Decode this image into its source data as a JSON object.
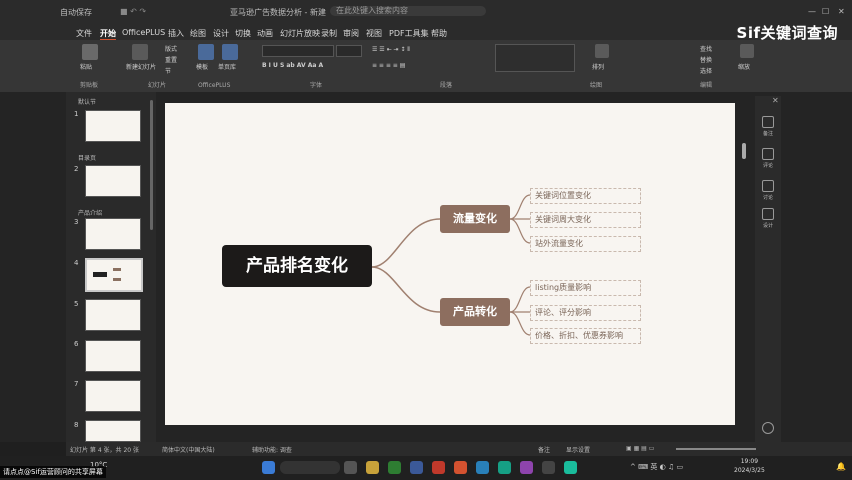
{
  "title_bar": {
    "autosave": "自动保存",
    "filename": "亚马逊广告数据分析 - 新建",
    "search": "在此处键入搜索内容"
  },
  "menu_tabs": [
    "文件",
    "开始",
    "OfficePLUS",
    "插入",
    "绘图",
    "设计",
    "切换",
    "动画",
    "幻灯片放映",
    "录制",
    "审阅",
    "视图",
    "PDF工具集",
    "帮助"
  ],
  "active_tab": "开始",
  "ribbon_groups": [
    "剪贴板",
    "幻灯片",
    "OfficePLUS",
    "字体",
    "段落",
    "绘图",
    "编辑"
  ],
  "ribbon_buttons": {
    "paste": "粘贴",
    "new_slide": "新建幻灯片",
    "layout": "版式",
    "reset": "重置",
    "section": "节",
    "template": "模板",
    "single_page": "单页库",
    "arrange": "排列",
    "find": "查找",
    "replace": "替换",
    "select": "选择",
    "zoom": "缩放"
  },
  "watermark": "Sif关键词查询",
  "sections": [
    "默认节",
    "目录页",
    "产品介绍"
  ],
  "slide_numbers": [
    "1",
    "2",
    "3",
    "4",
    "5",
    "6",
    "7",
    "8"
  ],
  "selected_slide": 4,
  "mindmap": {
    "root": "产品排名变化",
    "branches": [
      {
        "label": "流量变化",
        "leaves": [
          "关键词位置变化",
          "关键词周大变化",
          "站外流量变化"
        ]
      },
      {
        "label": "产品转化",
        "leaves": [
          "listing质量影响",
          "评论、评分影响",
          "价格、折扣、优惠券影响"
        ]
      }
    ]
  },
  "right_sidebar": [
    "备注",
    "评论",
    "讨论",
    "设计"
  ],
  "status": {
    "slide_pos": "幻灯片 第 4 张，共 20 张",
    "language": "简体中文(中国大陆)",
    "accessibility": "辅助功能: 调查",
    "notes": "备注",
    "display": "显示设置"
  },
  "taskbar": {
    "weather": "10°C",
    "time": "19:09",
    "date": "2024/3/25"
  },
  "caption": "请点点@Sif运营顾问的共享屏幕"
}
